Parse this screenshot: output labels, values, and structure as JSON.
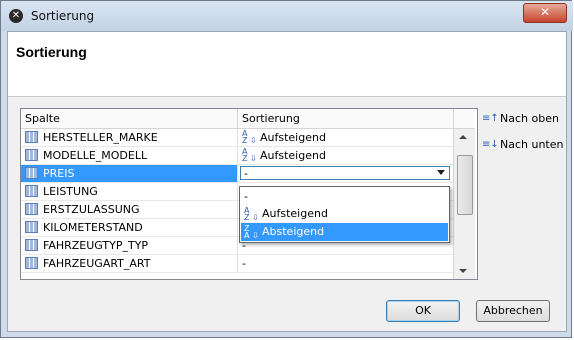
{
  "window": {
    "title": "Sortierung",
    "close_label": "✕"
  },
  "header": {
    "title": "Sortierung"
  },
  "table": {
    "headers": [
      "Spalte",
      "Sortierung"
    ],
    "rows": [
      {
        "column": "HERSTELLER_MARKE",
        "sort": "Aufsteigend",
        "icon": "sort-ascending-icon"
      },
      {
        "column": "MODELLE_MODELL",
        "sort": "Aufsteigend",
        "icon": "sort-ascending-icon"
      },
      {
        "column": "PREIS",
        "sort": "-",
        "selected": true
      },
      {
        "column": "LEISTUNG",
        "sort": ""
      },
      {
        "column": "ERSTZULASSUNG",
        "sort": ""
      },
      {
        "column": "KILOMETERSTAND",
        "sort": ""
      },
      {
        "column": "FAHRZEUGTYP_TYP",
        "sort": "-"
      },
      {
        "column": "FAHRZEUGART_ART",
        "sort": "-"
      }
    ]
  },
  "dropdown": {
    "options": [
      {
        "label": "-"
      },
      {
        "label": "Aufsteigend",
        "icon": "sort-ascending-icon"
      },
      {
        "label": "Absteigend",
        "icon": "sort-descending-icon",
        "highlighted": true
      }
    ]
  },
  "side_buttons": {
    "up": "Nach oben",
    "down": "Nach unten"
  },
  "buttons": {
    "ok": "OK",
    "cancel": "Abbrechen"
  }
}
